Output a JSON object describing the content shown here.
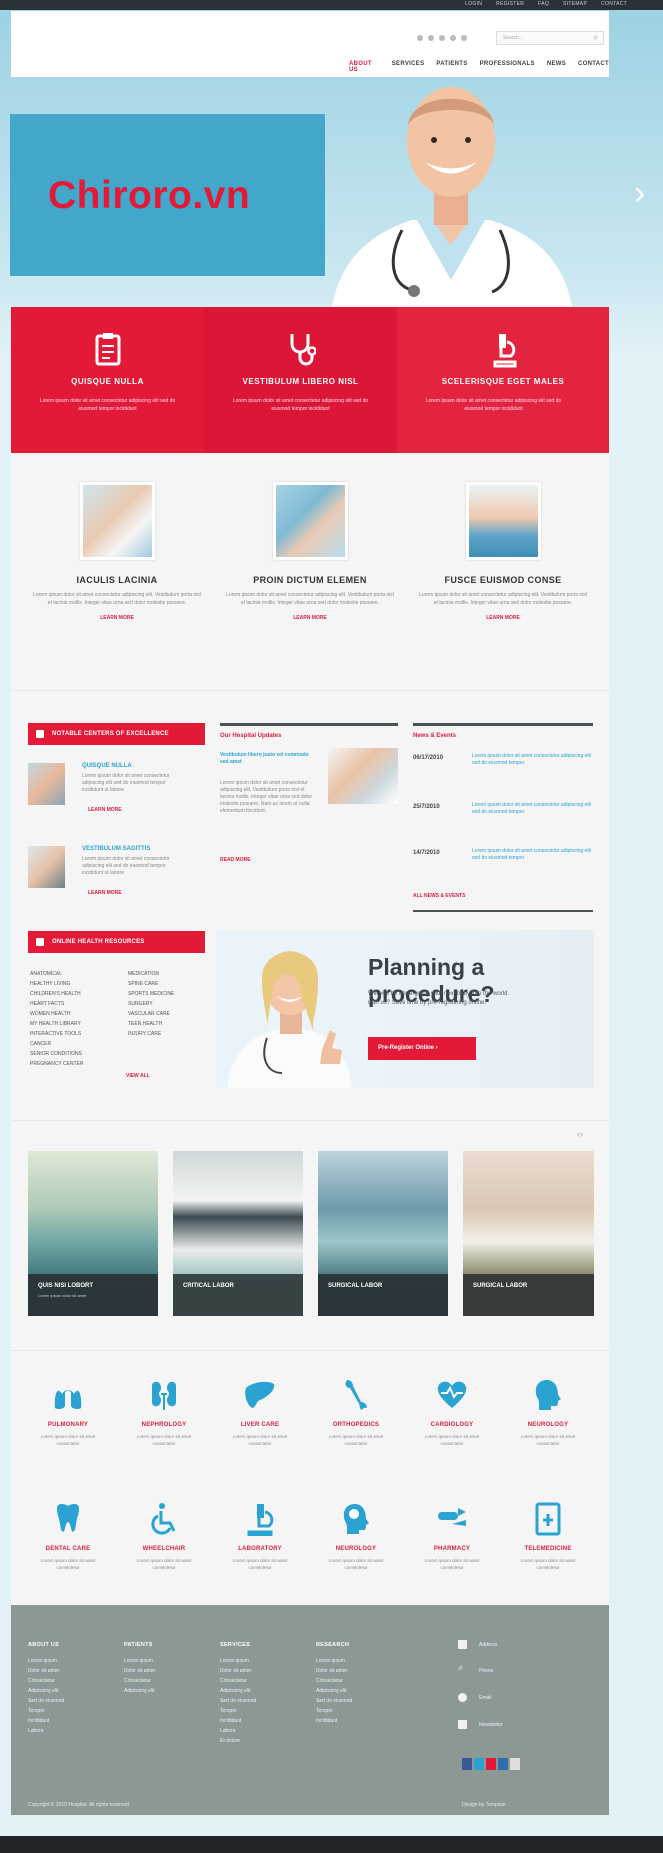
{
  "top_links": [
    "LOGIN",
    "REGISTER",
    "FAQ",
    "SITEMAP",
    "CONTACT"
  ],
  "header": {
    "search_placeholder": "Search...",
    "nav": [
      "ABOUT US",
      "SERVICES",
      "PATIENTS",
      "PROFESSIONALS",
      "NEWS",
      "CONTACT"
    ]
  },
  "brand": {
    "text": "Chiroro.vn"
  },
  "features": [
    {
      "title": "QUISQUE NULLA",
      "text": "Lorem ipsum dolor sit amet consectetur adipiscing elit sed do eiusmod tempor incididunt",
      "icon": "clipboard-icon"
    },
    {
      "title": "VESTIBULUM LIBERO NISL",
      "text": "Lorem ipsum dolor sit amet consectetur adipiscing elit sed do eiusmod tempor incididunt",
      "icon": "stethoscope-icon"
    },
    {
      "title": "SCELERISQUE EGET MALES",
      "text": "Lorem ipsum dolor sit amet consectetur adipiscing elit sed do eiusmod tempor incididunt",
      "icon": "microscope-icon"
    }
  ],
  "cards": [
    {
      "title": "IACULIS LACINIA",
      "text": "Lorem ipsum dolor sit amet consectetur adipiscing elit. Vestibulum porta nisl et lacinia mollis. Integer vitae urna sed dolor molestie posuere.",
      "more": "LEARN MORE"
    },
    {
      "title": "PROIN DICTUM ELEMEN",
      "text": "Lorem ipsum dolor sit amet consectetur adipiscing elit. Vestibulum porta nisl et lacinia mollis. Integer vitae urna sed dolor molestie posuere.",
      "more": "LEARN MORE"
    },
    {
      "title": "FUSCE EUISMOD CONSE",
      "text": "Lorem ipsum dolor sit amet consectetur adipiscing elit. Vestibulum porta nisl et lacinia mollis. Integer vitae urna sed dolor molestie posuere.",
      "more": "LEARN MORE"
    }
  ],
  "excellence": {
    "heading": "NOTABLE CENTERS OF EXCELLENCE",
    "items": [
      {
        "title": "QUISQUE NULLA",
        "text": "Lorem ipsum dolor sit amet consectetur adipiscing elit sed do eiusmod tempor incididunt ut labore",
        "more": "LEARN MORE"
      },
      {
        "title": "VESTIBULUM SAGITTIS",
        "text": "Lorem ipsum dolor sit amet consectetur adipiscing elit sed do eiusmod tempor incididunt ut labore",
        "more": "LEARN MORE"
      }
    ]
  },
  "hospital": {
    "heading": "Our Hospital Updates",
    "subtitle": "Vestibulum libero justo vel commodo sed amet",
    "text": "Lorem ipsum dolor sit amet consectetur adipiscing elit. Vestibulum porta nisl et lacinia mollis. Integer vitae urna sed dolor molestie posuere. Nam ac lorem ut nulla elementum tincidunt.",
    "more": "READ MORE"
  },
  "events": {
    "heading": "News & Events",
    "items": [
      {
        "date": "06/17/2010",
        "text": "Lorem ipsum dolor sit amet consectetur adipiscing elit sed do eiusmod tempor"
      },
      {
        "date": "25/7/2010",
        "text": "Lorem ipsum dolor sit amet consectetur adipiscing elit sed do eiusmod tempor"
      },
      {
        "date": "14/7/2010",
        "text": "Lorem ipsum dolor sit amet consectetur adipiscing elit sed do eiusmod tempor"
      }
    ],
    "more": "ALL NEWS & EVENTS"
  },
  "health": {
    "heading": "ONLINE HEALTH RESOURCES",
    "left": [
      "ANATOMICAL",
      "HEALTHY LIVING",
      "CHILDREN'S HEALTH",
      "HEART FACTS",
      "WOMEN HEALTH",
      "MY HEALTH LIBRARY",
      "INTERACTIVE TOOLS",
      "CANCER",
      "SENIOR CONDITIONS",
      "PREGNANCY CENTER"
    ],
    "right": [
      "MEDICATION",
      "SPINE CARE",
      "SPORTS MEDICINE",
      "SURGERY",
      "VASCULAR CARE",
      "TEEN HEALTH",
      "INJURY CARE"
    ],
    "more": "VIEW ALL"
  },
  "planning": {
    "title": "Planning a procedure?",
    "text": "Will you be undergoing your next baby into the world with us? Save time by pre-registering online.",
    "button": "Pre-Register Online"
  },
  "gallery": [
    {
      "caption": "QUIS NISI LOBORT",
      "sub": "Lorem ipsum dolor sit amet"
    },
    {
      "caption": "CRITICAL LABOR",
      "sub": ""
    },
    {
      "caption": "SURGICAL LABOR",
      "sub": ""
    },
    {
      "caption": "SURGICAL LABOR",
      "sub": ""
    }
  ],
  "services": [
    {
      "title": "PULMONARY",
      "text": "Lorem ipsum dolor sit amet consectetur",
      "icon": "lungs-icon"
    },
    {
      "title": "NEPHROLOGY",
      "text": "Lorem ipsum dolor sit amet consectetur",
      "icon": "kidney-icon"
    },
    {
      "title": "LIVER CARE",
      "text": "Lorem ipsum dolor sit amet consectetur",
      "icon": "liver-icon"
    },
    {
      "title": "ORTHOPEDICS",
      "text": "Lorem ipsum dolor sit amet consectetur",
      "icon": "bone-icon"
    },
    {
      "title": "CARDIOLOGY",
      "text": "Lorem ipsum dolor sit amet consectetur",
      "icon": "heart-icon"
    },
    {
      "title": "NEUROLOGY",
      "text": "Lorem ipsum dolor sit amet consectetur",
      "icon": "head-icon"
    },
    {
      "title": "DENTAL CARE",
      "text": "Lorem ipsum dolor sit amet consectetur",
      "icon": "tooth-icon"
    },
    {
      "title": "WHEELCHAIR",
      "text": "Lorem ipsum dolor sit amet consectetur",
      "icon": "wheelchair-icon"
    },
    {
      "title": "LABORATORY",
      "text": "Lorem ipsum dolor sit amet consectetur",
      "icon": "microscope-icon"
    },
    {
      "title": "NEUROLOGY",
      "text": "Lorem ipsum dolor sit amet consectetur",
      "icon": "brain-icon"
    },
    {
      "title": "PHARMACY",
      "text": "Lorem ipsum dolor sit amet consectetur",
      "icon": "pills-icon"
    },
    {
      "title": "TELEMEDICINE",
      "text": "Lorem ipsum dolor sit amet consectetur",
      "icon": "tablet-icon"
    }
  ],
  "footer": {
    "cols": [
      {
        "title": "ABOUT US",
        "items": [
          "Lorem ipsum",
          "Dolor sit amet",
          "Consectetur",
          "Adipiscing elit",
          "Sed do eiusmod",
          "Tempor",
          "Incididunt",
          "Labore"
        ]
      },
      {
        "title": "PATIENTS",
        "items": [
          "Lorem ipsum",
          "Dolor sit amet",
          "Consectetur",
          "Adipiscing elit"
        ]
      },
      {
        "title": "SERVICES",
        "items": [
          "Lorem ipsum",
          "Dolor sit amet",
          "Consectetur",
          "Adipiscing elit",
          "Sed do eiusmod",
          "Tempor",
          "Incididunt",
          "Labore",
          "Et dolore"
        ]
      },
      {
        "title": "RESEARCH",
        "items": [
          "Lorem ipsum",
          "Dolor sit amet",
          "Consectetur",
          "Adipiscing elit",
          "Sed do eiusmod",
          "Tempor",
          "Incididunt"
        ]
      }
    ],
    "contact": [
      "Address",
      "Phone",
      "Email",
      "Newsletter"
    ],
    "copyright": "Copyright © 2010 Hospital. All rights reserved.",
    "credits": "Design by Template"
  }
}
